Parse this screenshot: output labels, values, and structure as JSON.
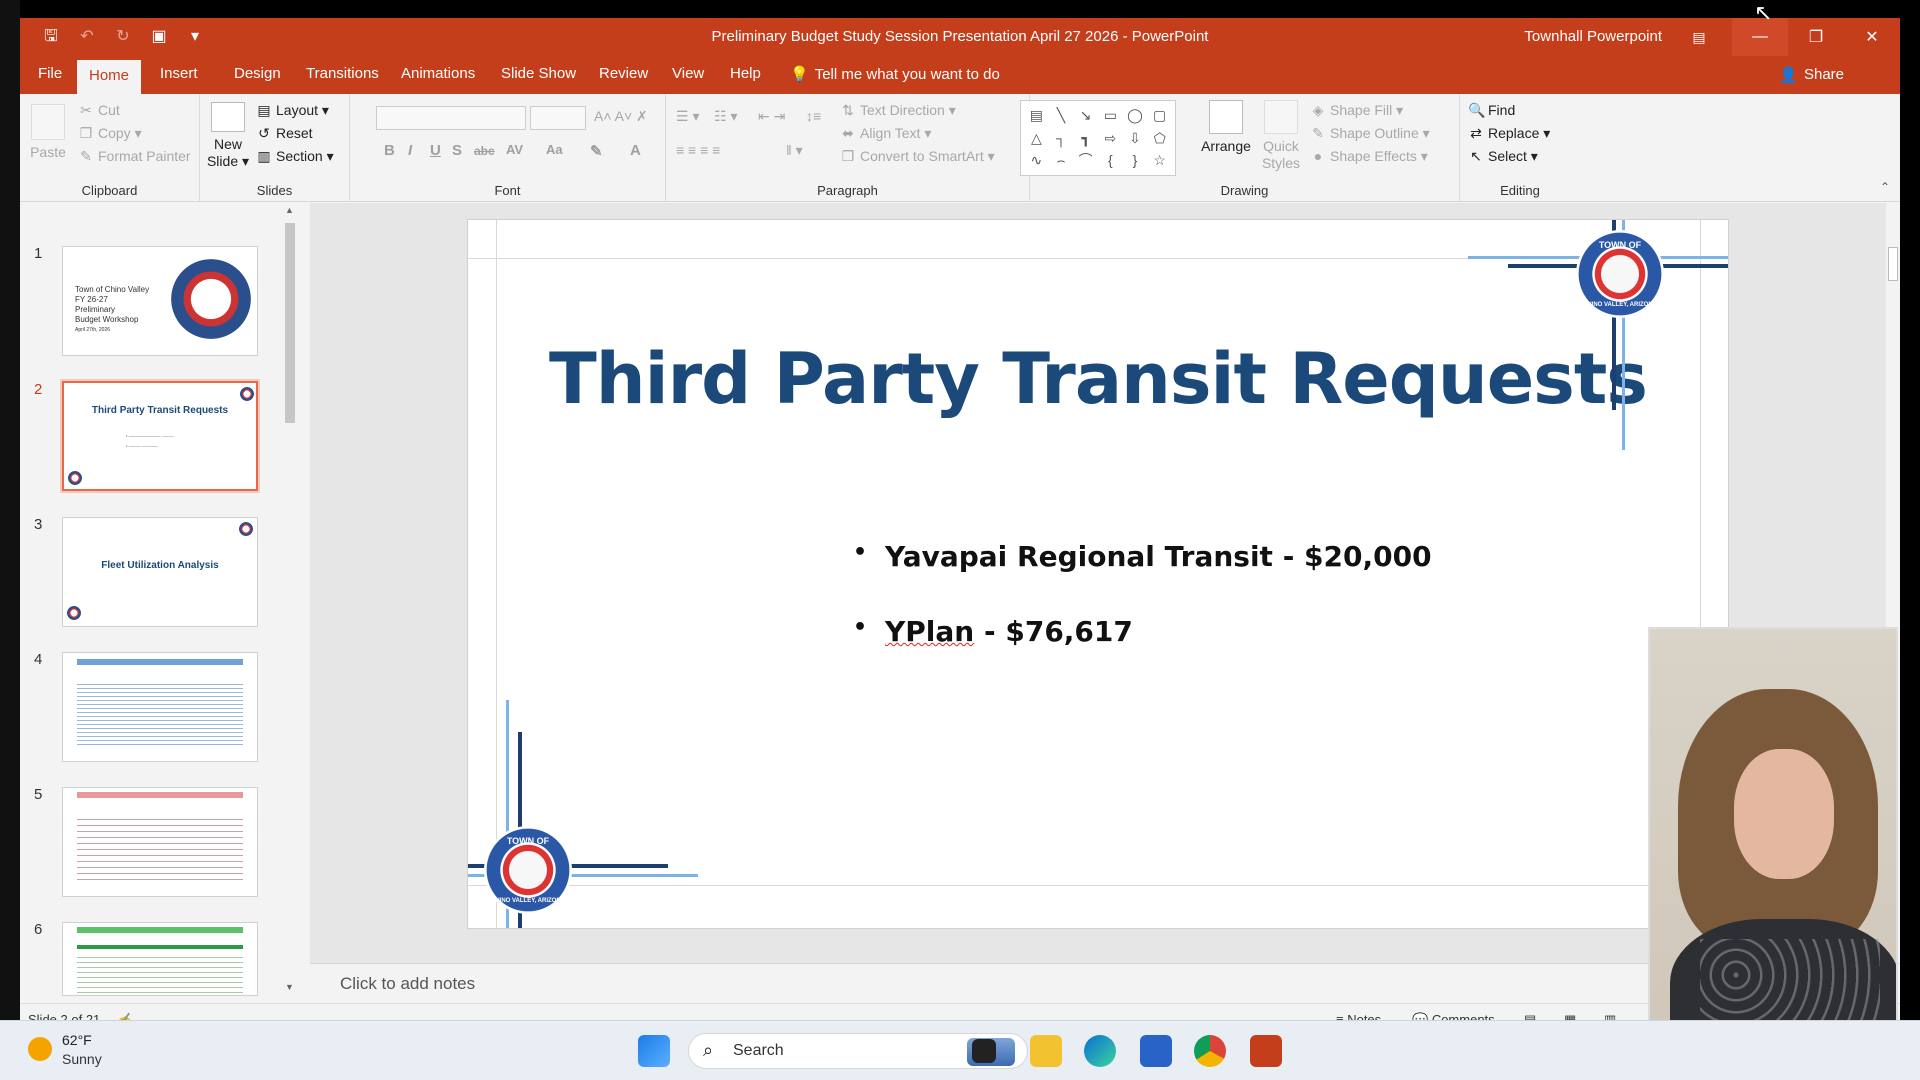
{
  "window": {
    "title": "Preliminary Budget Study Session Presentation April 27 2026  -  PowerPoint",
    "account": "Townhall Powerpoint"
  },
  "tabs": [
    "File",
    "Home",
    "Insert",
    "Design",
    "Transitions",
    "Animations",
    "Slide Show",
    "Review",
    "View",
    "Help"
  ],
  "tell_me": "Tell me what you want to do",
  "share": "Share",
  "ribbon": {
    "clipboard": {
      "label": "Clipboard",
      "paste": "Paste",
      "cut": "Cut",
      "copy": "Copy",
      "format_painter": "Format Painter"
    },
    "slides": {
      "label": "Slides",
      "new_slide_1": "New",
      "new_slide_2": "Slide",
      "layout": "Layout",
      "reset": "Reset",
      "section": "Section"
    },
    "font": {
      "label": "Font"
    },
    "paragraph": {
      "label": "Paragraph",
      "text_direction": "Text Direction",
      "align_text": "Align Text",
      "convert_smartart": "Convert to SmartArt"
    },
    "drawing": {
      "label": "Drawing",
      "arrange": "Arrange",
      "quick_1": "Quick",
      "quick_2": "Styles",
      "shape_fill": "Shape Fill",
      "shape_outline": "Shape Outline",
      "shape_effects": "Shape Effects"
    },
    "editing": {
      "label": "Editing",
      "find": "Find",
      "replace": "Replace",
      "select": "Select"
    }
  },
  "thumbnails": [
    {
      "num": "1",
      "lines": [
        "Town of Chino Valley",
        "FY 26-27",
        "Preliminary",
        "Budget Workshop",
        "April 27th, 2026"
      ]
    },
    {
      "num": "2",
      "title": "Third Party Transit Requests",
      "active": true
    },
    {
      "num": "3",
      "title": "Fleet Utilization Analysis"
    },
    {
      "num": "4"
    },
    {
      "num": "5"
    },
    {
      "num": "6"
    }
  ],
  "slide": {
    "title": "Third Party Transit Requests",
    "bullets": [
      "Yavapai Regional Transit - $20,000",
      "YPlan",
      " - $76,617"
    ],
    "seal_top": "TOWN OF",
    "seal_bottom": "CHINO VALLEY, ARIZONA"
  },
  "notes_placeholder": "Click to add notes",
  "status": {
    "slide_info": "Slide 2 of 21",
    "notes": "Notes",
    "comments": "Comments"
  },
  "taskbar": {
    "temp": "62°F",
    "condition": "Sunny",
    "search": "Search"
  },
  "colors": {
    "accent": "#c43e1c",
    "slide_title": "#1b4a7a"
  }
}
